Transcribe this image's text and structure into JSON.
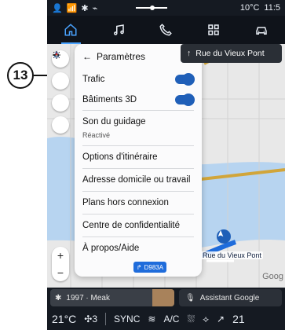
{
  "annotation": {
    "number": "13"
  },
  "status": {
    "temperature": "10°C",
    "time": "11:5"
  },
  "tabs": {
    "items": [
      {
        "name": "home",
        "active": true
      },
      {
        "name": "media",
        "active": false
      },
      {
        "name": "phone",
        "active": false
      },
      {
        "name": "apps",
        "active": false
      },
      {
        "name": "vehicle",
        "active": false
      }
    ]
  },
  "nav": {
    "route_chip": "Rue du Vieux Pont",
    "road_label": "Rue du Vieux Pont",
    "road_tag": "D983A",
    "watermark": "Goog"
  },
  "settings": {
    "title": "Paramètres",
    "items": {
      "traffic": {
        "label": "Trafic",
        "enabled": true
      },
      "buildings3d": {
        "label": "Bâtiments 3D",
        "enabled": true
      },
      "voice": {
        "label": "Son du guidage",
        "sub": "Réactivé"
      },
      "route_options": {
        "label": "Options d'itinéraire"
      },
      "home_work": {
        "label": "Adresse domicile ou travail"
      },
      "offline_maps": {
        "label": "Plans hors connexion"
      },
      "privacy": {
        "label": "Centre de confidentialité"
      },
      "about": {
        "label": "À propos/Aide"
      }
    }
  },
  "media": {
    "text": "1997 · Meak"
  },
  "assistant": {
    "label": "Assistant Google"
  },
  "climate": {
    "left_temp": "21",
    "left_unit": "°C",
    "fan_level": "3",
    "sync": "SYNC",
    "ac": "A/C",
    "right_temp": "21"
  },
  "colors": {
    "accent": "#1f5fb8",
    "tab_active": "#4aa3ff",
    "map_water": "#b7d4f0",
    "road_blue": "#1f6cdb",
    "panel_bg": "#fbfbfc"
  }
}
